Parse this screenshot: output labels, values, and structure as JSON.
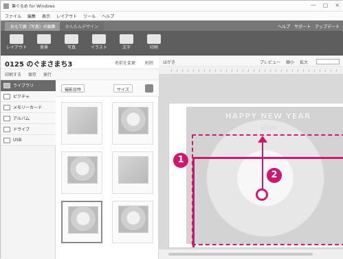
{
  "window": {
    "title": "筆ぐるめ for Windows",
    "controls": [
      "—",
      "□",
      "×"
    ]
  },
  "menu": {
    "items": [
      "ファイル",
      "編集",
      "表示",
      "レイアウト",
      "ツール",
      "ヘルプ"
    ]
  },
  "tabs": {
    "active": "おもて面（写真）の編集",
    "inactive": "かんたんデザイン",
    "right_links": [
      "ヘルプ",
      "サポート",
      "アップデート"
    ]
  },
  "toolbar": {
    "items": [
      {
        "label": "レイアウト",
        "icon": "layout-icon"
      },
      {
        "label": "背景",
        "icon": "background-icon"
      },
      {
        "label": "写真",
        "icon": "photo-icon"
      },
      {
        "label": "イラスト",
        "icon": "illustration-icon"
      },
      {
        "label": "文字",
        "icon": "text-icon"
      },
      {
        "label": "印刷",
        "icon": "print-icon"
      }
    ]
  },
  "document": {
    "name": "0125 のぐまさまち3",
    "links": [
      "名前を変更",
      "削除"
    ],
    "subbar": [
      "印刷する",
      "保存",
      "発行"
    ]
  },
  "sidebar": {
    "items": [
      {
        "label": "ライブラリ",
        "selected": true
      },
      {
        "label": "ピクチャ",
        "selected": false
      },
      {
        "label": "メモリーカード",
        "selected": false
      },
      {
        "label": "アルバム",
        "selected": false
      },
      {
        "label": "ドライブ",
        "selected": false
      },
      {
        "label": "USB",
        "selected": false
      }
    ]
  },
  "grid": {
    "sort_label": "撮影日時",
    "size_label": "サイズ",
    "thumbs": [
      {
        "caption": ""
      },
      {
        "caption": ""
      },
      {
        "caption": ""
      },
      {
        "caption": ""
      },
      {
        "caption": ""
      },
      {
        "caption": ""
      }
    ]
  },
  "editor": {
    "left_label": "はがき",
    "right_items": [
      "プレビュー",
      "縮小",
      "拡大"
    ],
    "search_placeholder": ""
  },
  "card": {
    "header": "HAPPY NEW YEAR",
    "subheader": "謹賀新年"
  },
  "callouts": {
    "one": "1",
    "two": "2"
  },
  "colors": {
    "accent": "#d0166f"
  }
}
